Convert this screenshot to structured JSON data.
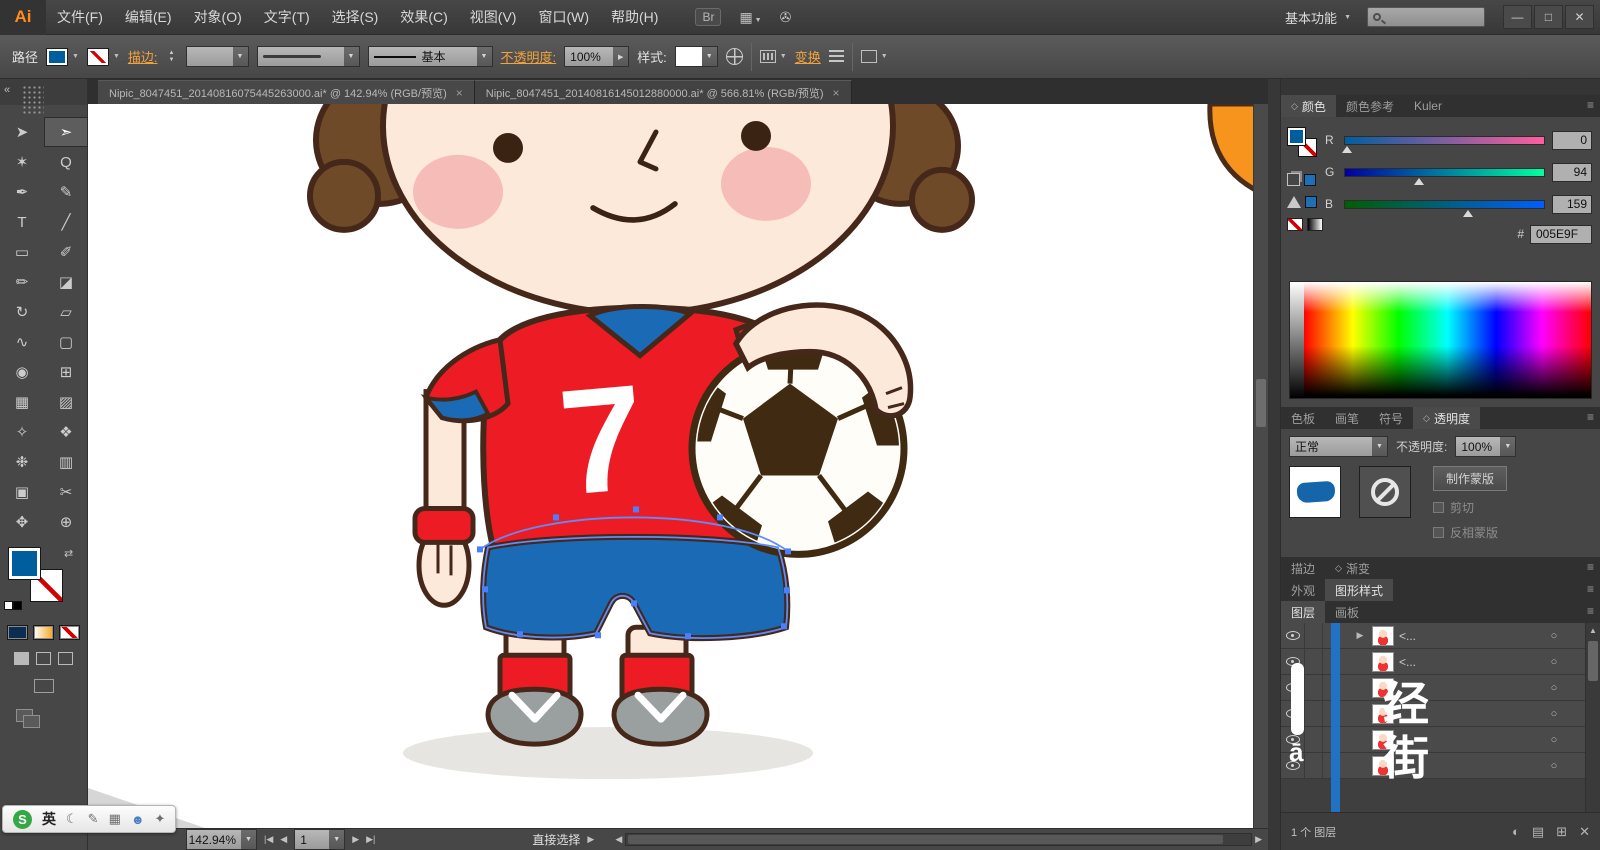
{
  "icons": {
    "menu": "≡",
    "tab_close": "×",
    "arrow_down": "▼",
    "arrow_up": "▲",
    "arrow_right": "▶",
    "arrow_left": "◀",
    "nav_first": "|◀",
    "nav_last": "▶|",
    "target": "○",
    "diamond": "◇",
    "collapse": "«",
    "swap": "⇄",
    "win_minimize": "—",
    "win_restore": "□",
    "win_close": "✕",
    "layout": "▦",
    "rotate_view": "✇",
    "expand": "▶",
    "scroll_up": "▲",
    "panel_mask": "◐",
    "panel_folder": "▤",
    "panel_new": "⊞",
    "panel_delete": "✕"
  },
  "window": {
    "logo": "Ai",
    "menus": [
      "文件(F)",
      "编辑(E)",
      "对象(O)",
      "文字(T)",
      "选择(S)",
      "效果(C)",
      "视图(V)",
      "窗口(W)",
      "帮助(H)"
    ],
    "bridge": "Br",
    "workspace": "基本功能"
  },
  "controlbar": {
    "object_label": "路径",
    "stroke_label": "描边:",
    "brush_style": "基本",
    "opacity_label": "不透明度:",
    "opacity_value": "100%",
    "style_label": "样式:",
    "transform_label": "变换"
  },
  "doc_tabs": [
    {
      "title": "Nipic_8047451_20140816075445263000.ai* @ 142.94% (RGB/预览)"
    },
    {
      "title": "Nipic_8047451_20140816145012880000.ai* @ 566.81% (RGB/预览)"
    }
  ],
  "toolbar": {
    "tools": [
      {
        "name": "selection",
        "glyph": "➤"
      },
      {
        "name": "direct-selection",
        "glyph": "➣"
      },
      {
        "name": "magic-wand",
        "glyph": "✶"
      },
      {
        "name": "lasso",
        "glyph": "Q"
      },
      {
        "name": "pen",
        "glyph": "✒"
      },
      {
        "name": "pencil",
        "glyph": "✎"
      },
      {
        "name": "type",
        "glyph": "T"
      },
      {
        "name": "line-segment",
        "glyph": "╱"
      },
      {
        "name": "rectangle",
        "glyph": "▭"
      },
      {
        "name": "paintbrush",
        "glyph": "✐"
      },
      {
        "name": "blob-brush",
        "glyph": "✏"
      },
      {
        "name": "eraser",
        "glyph": "◪"
      },
      {
        "name": "rotate",
        "glyph": "↻"
      },
      {
        "name": "scale",
        "glyph": "▱"
      },
      {
        "name": "width-tool",
        "glyph": "∿"
      },
      {
        "name": "free-transform",
        "glyph": "▢"
      },
      {
        "name": "shape-builder",
        "glyph": "◉"
      },
      {
        "name": "perspective-grid",
        "glyph": "⊞"
      },
      {
        "name": "mesh",
        "glyph": "▦"
      },
      {
        "name": "gradient",
        "glyph": "▨"
      },
      {
        "name": "eyedropper",
        "glyph": "✧"
      },
      {
        "name": "blend",
        "glyph": "❖"
      },
      {
        "name": "symbol-sprayer",
        "glyph": "❉"
      },
      {
        "name": "column-graph",
        "glyph": "▥"
      },
      {
        "name": "artboard",
        "glyph": "▣"
      },
      {
        "name": "slice",
        "glyph": "✂"
      },
      {
        "name": "hand",
        "glyph": "✥"
      },
      {
        "name": "zoom",
        "glyph": "⊕"
      }
    ]
  },
  "canvas": {
    "jersey_number": "7"
  },
  "color_panel": {
    "tabs": [
      "颜色",
      "颜色参考",
      "Kuler"
    ],
    "channels": [
      {
        "label": "R",
        "value": "0"
      },
      {
        "label": "G",
        "value": "94"
      },
      {
        "label": "B",
        "value": "159"
      }
    ],
    "hex_label": "#",
    "hex_value": "005E9F"
  },
  "swatch_tabs": [
    "色板",
    "画笔",
    "符号",
    "透明度"
  ],
  "transparency": {
    "blend_mode": "正常",
    "opacity_label": "不透明度:",
    "opacity_value": "100%",
    "make_mask": "制作蒙版",
    "clip": "剪切",
    "invert_mask": "反相蒙版"
  },
  "stroke_gradient_tabs": [
    "描边",
    "渐变"
  ],
  "appearance_tabs": [
    "外观",
    "图形样式"
  ],
  "layers_tabs": [
    "图层",
    "画板"
  ],
  "layers_panel": {
    "rows": [
      {
        "name": "<..."
      },
      {
        "name": "<..."
      },
      {
        "name": ""
      },
      {
        "name": ""
      },
      {
        "name": ""
      },
      {
        "name": ""
      }
    ],
    "watermark": [
      "经",
      "街",
      "ā"
    ],
    "footer_count": "1 个 图层"
  },
  "status_bar": {
    "zoom": "142.94%",
    "artboard": "1",
    "tool": "直接选择"
  },
  "ime": {
    "logo": "S",
    "lang": "英",
    "icons": [
      "☾",
      "✎",
      "▦",
      "☻",
      "✦"
    ]
  }
}
